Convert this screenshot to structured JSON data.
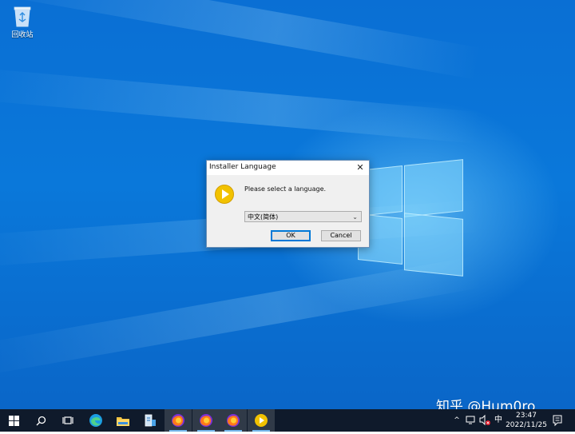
{
  "desktop": {
    "icons": [
      {
        "label": "回收站",
        "icon": "recycle-bin-icon"
      }
    ]
  },
  "dialog": {
    "title": "Installer Language",
    "close_symbol": "✕",
    "prompt": "Please select a language.",
    "language_selected": "中文(简体)",
    "ok_label": "OK",
    "cancel_label": "Cancel",
    "icon": "installer-play-icon"
  },
  "watermark": "知乎 @Hum0ro",
  "taskbar": {
    "items": [
      {
        "name": "start-button",
        "icon": "windows-logo-icon"
      },
      {
        "name": "search-button",
        "icon": "search-icon"
      },
      {
        "name": "task-view-button",
        "icon": "task-view-icon"
      },
      {
        "name": "edge-button",
        "icon": "edge-icon"
      },
      {
        "name": "file-explorer-button",
        "icon": "folder-icon"
      },
      {
        "name": "server-manager-button",
        "icon": "server-icon"
      },
      {
        "name": "firefox-button-1",
        "icon": "firefox-icon"
      },
      {
        "name": "firefox-button-2",
        "icon": "firefox-icon"
      },
      {
        "name": "firefox-button-3",
        "icon": "firefox-icon"
      },
      {
        "name": "installer-button",
        "icon": "installer-play-icon"
      }
    ],
    "tray": {
      "chevron": "^",
      "ime": "中",
      "time": "23:47",
      "date": "2022/11/25"
    }
  },
  "colors": {
    "accent": "#0078d7",
    "taskbar": "#0f1a2b",
    "desktop": "#0a72d6",
    "installer_icon": "#f2c200"
  }
}
